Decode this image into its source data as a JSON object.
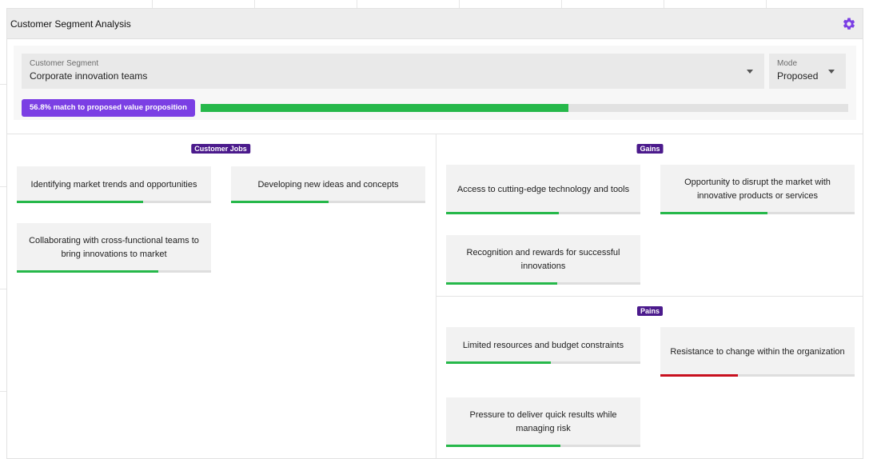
{
  "header": {
    "title": "Customer Segment Analysis",
    "settings_icon": "gear-icon"
  },
  "controls": {
    "segment": {
      "label": "Customer Segment",
      "value": "Corporate innovation teams"
    },
    "mode": {
      "label": "Mode",
      "value": "Proposed"
    },
    "match": {
      "text": "56.8% match to proposed value proposition",
      "fraction": 0.568
    }
  },
  "colors": {
    "accent": "#7b3fe4",
    "tag": "#4b1a8c",
    "positive": "#26b84a",
    "negative": "#c8101e"
  },
  "jobs": {
    "tag": "Customer Jobs",
    "cards": [
      {
        "text": "Identifying market trends and opportunities",
        "fit": 0.65,
        "status": "positive"
      },
      {
        "text": "Developing new ideas and concepts",
        "fit": 0.5,
        "status": "positive"
      },
      {
        "text": "Collaborating with cross-functional teams to bring innovations to market",
        "fit": 0.73,
        "status": "positive"
      }
    ]
  },
  "gains": {
    "tag": "Gains",
    "cards": [
      {
        "text": "Access to cutting-edge technology and tools",
        "fit": 0.58,
        "status": "positive"
      },
      {
        "text": "Opportunity to disrupt the market with innovative products or services",
        "fit": 0.55,
        "status": "positive"
      },
      {
        "text": "Recognition and rewards for successful innovations",
        "fit": 0.57,
        "status": "positive"
      }
    ]
  },
  "pains": {
    "tag": "Pains",
    "cards": [
      {
        "text": "Limited resources and budget constraints",
        "fit": 0.54,
        "status": "positive"
      },
      {
        "text": "Resistance to change within the organization",
        "fit": 0.4,
        "status": "negative"
      },
      {
        "text": "Pressure to deliver quick results while managing risk",
        "fit": 0.59,
        "status": "positive"
      }
    ]
  }
}
